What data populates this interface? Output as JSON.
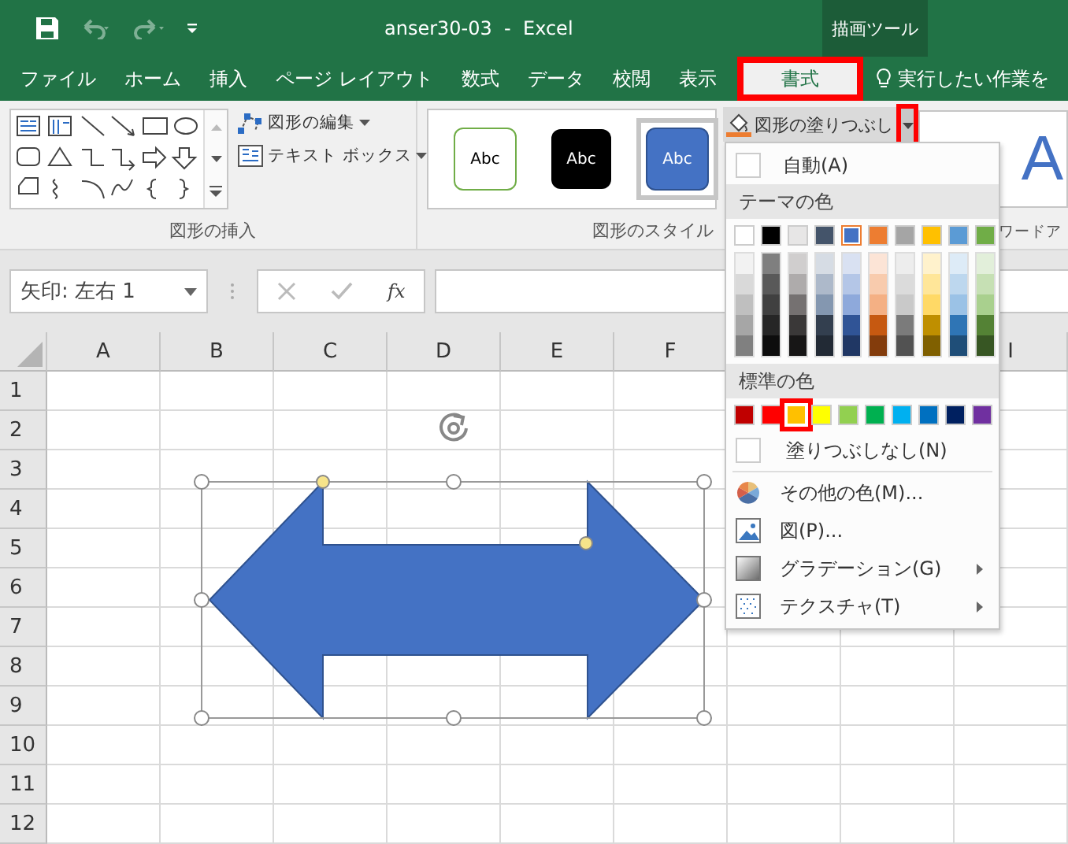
{
  "title_bar": {
    "title": "anser30-03  -  Excel",
    "contextual_group": "描画ツール"
  },
  "tabs": [
    {
      "label": "ファイル",
      "selected": false,
      "highlighted": false
    },
    {
      "label": "ホーム",
      "selected": false,
      "highlighted": false
    },
    {
      "label": "挿入",
      "selected": false,
      "highlighted": false
    },
    {
      "label": "ページ レイアウト",
      "selected": false,
      "highlighted": false
    },
    {
      "label": "数式",
      "selected": false,
      "highlighted": false
    },
    {
      "label": "データ",
      "selected": false,
      "highlighted": false
    },
    {
      "label": "校閲",
      "selected": false,
      "highlighted": false
    },
    {
      "label": "表示",
      "selected": false,
      "highlighted": false
    },
    {
      "label": "書式",
      "selected": true,
      "highlighted": true
    }
  ],
  "tell_me": "実行したい作業を",
  "insert_shapes_group": {
    "label": "図形の挿入",
    "commands": [
      {
        "label": "図形の編集",
        "kind": "edit"
      },
      {
        "label": "テキスト ボックス",
        "kind": "textbox"
      }
    ]
  },
  "shape_styles_group": {
    "label": "図形のスタイル",
    "presets": [
      {
        "text": "Abc",
        "kind": "outline",
        "selected": false
      },
      {
        "text": "Abc",
        "kind": "dark",
        "selected": false
      },
      {
        "text": "Abc",
        "kind": "accent",
        "selected": true
      }
    ]
  },
  "fill_button": {
    "label": "図形の塗りつぶし",
    "dropdown_highlighted": true
  },
  "wordart_group": {
    "preview": "A",
    "label": "ワードア"
  },
  "formula_bar": {
    "name_box": "矢印: 左右 1",
    "function_label": "fx"
  },
  "sheet": {
    "columns": [
      "A",
      "B",
      "C",
      "D",
      "E",
      "F",
      null,
      null,
      "I"
    ],
    "rows": [
      "1",
      "2",
      "3",
      "4",
      "5",
      "6",
      "7",
      "8",
      "9",
      "10",
      "11",
      "12"
    ]
  },
  "shape": {
    "selected": true
  },
  "fill_menu": {
    "automatic": "自動(A)",
    "theme_heading": "テーマの色",
    "theme_colors": [
      {
        "color": "#ffffff",
        "selected": false,
        "shades": [
          {
            "color": "#f2f2f2"
          },
          {
            "color": "#d9d9d9"
          },
          {
            "color": "#bfbfbf"
          },
          {
            "color": "#a6a6a6"
          },
          {
            "color": "#808080"
          }
        ]
      },
      {
        "color": "#000000",
        "selected": false,
        "shades": [
          {
            "color": "#7f7f7f"
          },
          {
            "color": "#595959"
          },
          {
            "color": "#404040"
          },
          {
            "color": "#262626"
          },
          {
            "color": "#0d0d0d"
          }
        ]
      },
      {
        "color": "#e7e6e6",
        "selected": false,
        "shades": [
          {
            "color": "#d0cece"
          },
          {
            "color": "#aeabab"
          },
          {
            "color": "#757171"
          },
          {
            "color": "#3a3838"
          },
          {
            "color": "#171616"
          }
        ]
      },
      {
        "color": "#44546a",
        "selected": false,
        "shades": [
          {
            "color": "#d6dce4"
          },
          {
            "color": "#adb9ca"
          },
          {
            "color": "#8497b0"
          },
          {
            "color": "#333f4f"
          },
          {
            "color": "#222a35"
          }
        ]
      },
      {
        "color": "#4472c4",
        "selected": true,
        "shades": [
          {
            "color": "#d9e1f2"
          },
          {
            "color": "#b4c6e7"
          },
          {
            "color": "#8ea9db"
          },
          {
            "color": "#305496"
          },
          {
            "color": "#203764"
          }
        ]
      },
      {
        "color": "#ed7d31",
        "selected": false,
        "shades": [
          {
            "color": "#fce4d6"
          },
          {
            "color": "#f8cbad"
          },
          {
            "color": "#f4b084"
          },
          {
            "color": "#c65911"
          },
          {
            "color": "#833c0c"
          }
        ]
      },
      {
        "color": "#a5a5a5",
        "selected": false,
        "shades": [
          {
            "color": "#ededed"
          },
          {
            "color": "#dbdbdb"
          },
          {
            "color": "#c9c9c9"
          },
          {
            "color": "#7b7b7b"
          },
          {
            "color": "#525252"
          }
        ]
      },
      {
        "color": "#ffc000",
        "selected": false,
        "shades": [
          {
            "color": "#fff2cc"
          },
          {
            "color": "#ffe699"
          },
          {
            "color": "#ffd966"
          },
          {
            "color": "#bf8f00"
          },
          {
            "color": "#806000"
          }
        ]
      },
      {
        "color": "#5b9bd5",
        "selected": false,
        "shades": [
          {
            "color": "#ddebf7"
          },
          {
            "color": "#bdd7ee"
          },
          {
            "color": "#9bc2e6"
          },
          {
            "color": "#2f75b5"
          },
          {
            "color": "#1f4e78"
          }
        ]
      },
      {
        "color": "#70ad47",
        "selected": false,
        "shades": [
          {
            "color": "#e2efda"
          },
          {
            "color": "#c6e0b4"
          },
          {
            "color": "#a9d08e"
          },
          {
            "color": "#548235"
          },
          {
            "color": "#375623"
          }
        ]
      }
    ],
    "standard_heading": "標準の色",
    "standard_colors": [
      {
        "color": "#c00000",
        "highlighted": false
      },
      {
        "color": "#ff0000",
        "highlighted": false
      },
      {
        "color": "#ffc000",
        "highlighted": true
      },
      {
        "color": "#ffff00",
        "highlighted": false
      },
      {
        "color": "#92d050",
        "highlighted": false
      },
      {
        "color": "#00b050",
        "highlighted": false
      },
      {
        "color": "#00b0f0",
        "highlighted": false
      },
      {
        "color": "#0070c0",
        "highlighted": false
      },
      {
        "color": "#002060",
        "highlighted": false
      },
      {
        "color": "#7030a0",
        "highlighted": false
      }
    ],
    "items": [
      {
        "label": "塗りつぶしなし(N)",
        "kind": "none",
        "submenu": false
      },
      {
        "label": "その他の色(M)...",
        "kind": "more",
        "submenu": false
      },
      {
        "label": "図(P)...",
        "kind": "picture",
        "submenu": false
      },
      {
        "label": "グラデーション(G)",
        "kind": "gradient",
        "submenu": true
      },
      {
        "label": "テクスチャ(T)",
        "kind": "texture",
        "submenu": true
      }
    ]
  }
}
